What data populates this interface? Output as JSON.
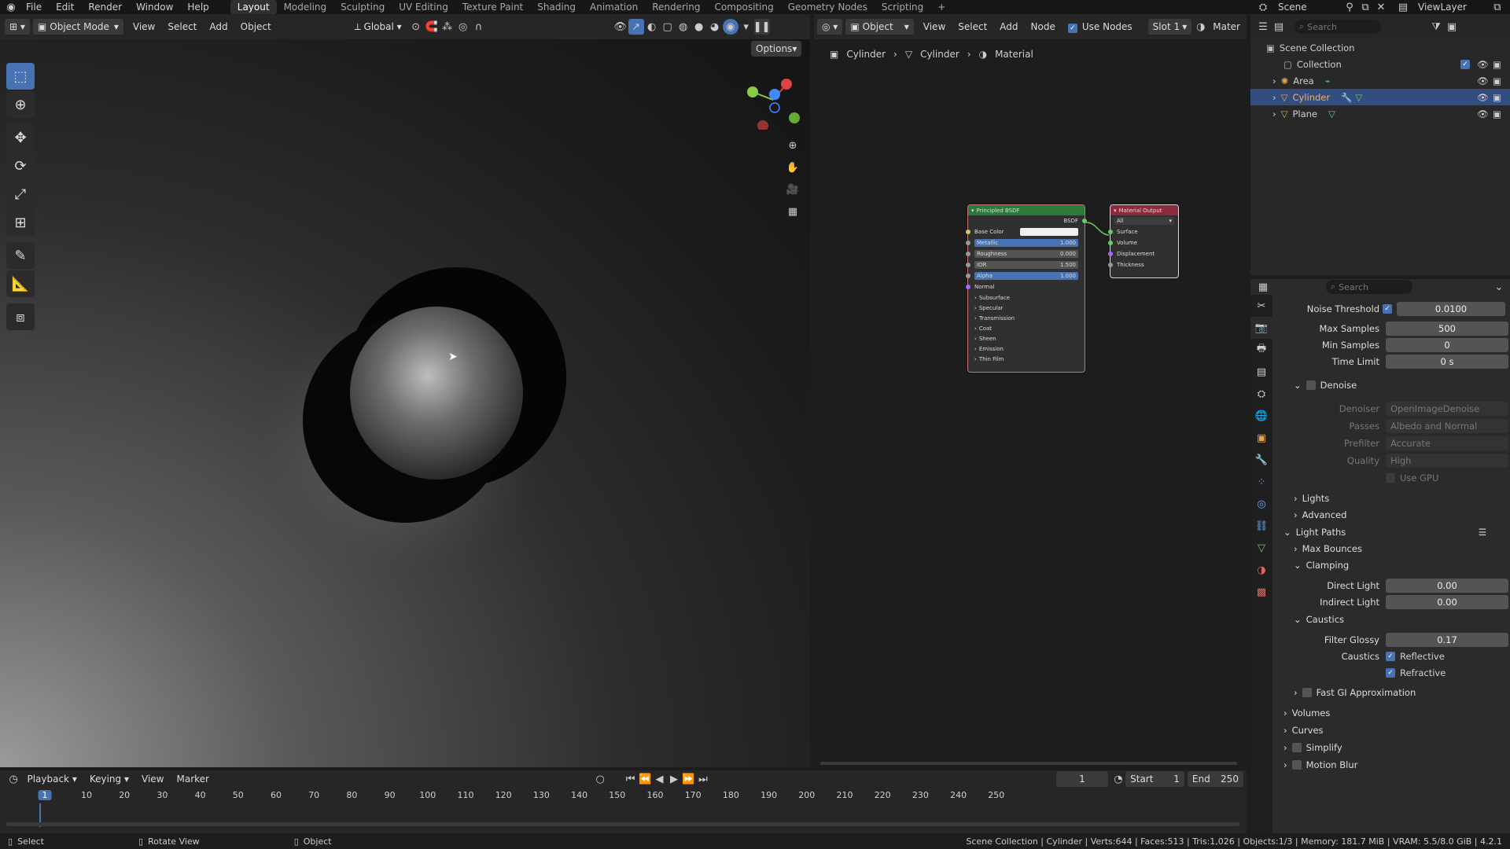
{
  "menu": [
    "File",
    "Edit",
    "Render",
    "Window",
    "Help"
  ],
  "workspaces": [
    "Layout",
    "Modeling",
    "Sculpting",
    "UV Editing",
    "Texture Paint",
    "Shading",
    "Animation",
    "Rendering",
    "Compositing",
    "Geometry Nodes",
    "Scripting"
  ],
  "scene": {
    "label": "Scene",
    "view_layer": "ViewLayer"
  },
  "viewport_header": {
    "mode": "Object Mode",
    "menus": [
      "View",
      "Select",
      "Add",
      "Object"
    ],
    "orientation": "Global",
    "options": "Options"
  },
  "node_header": {
    "type": "Object",
    "menus": [
      "View",
      "Select",
      "Add",
      "Node"
    ],
    "use_nodes": "Use Nodes",
    "slot": "Slot 1",
    "material": "Mater"
  },
  "breadcrumb": [
    "Cylinder",
    "Cylinder",
    "Material"
  ],
  "bsdf_node": {
    "title": "Principled BSDF",
    "output": "BSDF",
    "base_color": "Base Color",
    "fields": [
      {
        "label": "Metallic",
        "value": "1.000",
        "blue": true
      },
      {
        "label": "Roughness",
        "value": "0.000",
        "blue": false
      },
      {
        "label": "IOR",
        "value": "1.500",
        "blue": false
      },
      {
        "label": "Alpha",
        "value": "1.000",
        "blue": true
      }
    ],
    "normal": "Normal",
    "panels": [
      "Subsurface",
      "Specular",
      "Transmission",
      "Coat",
      "Sheen",
      "Emission",
      "Thin Film"
    ]
  },
  "output_node": {
    "title": "Material Output",
    "target": "All",
    "inputs": [
      "Surface",
      "Volume",
      "Displacement",
      "Thickness"
    ]
  },
  "outliner": {
    "search_placeholder": "Search",
    "items": [
      {
        "name": "Scene Collection",
        "indent": 0,
        "selected": false
      },
      {
        "name": "Collection",
        "indent": 1,
        "selected": false
      },
      {
        "name": "Area",
        "indent": 2,
        "selected": false
      },
      {
        "name": "Cylinder",
        "indent": 2,
        "selected": true
      },
      {
        "name": "Plane",
        "indent": 2,
        "selected": false
      }
    ]
  },
  "properties": {
    "search_placeholder": "Search",
    "noise_threshold": {
      "label": "Noise Threshold",
      "value": "0.0100"
    },
    "max_samples": {
      "label": "Max Samples",
      "value": "500"
    },
    "min_samples": {
      "label": "Min Samples",
      "value": "0"
    },
    "time_limit": {
      "label": "Time Limit",
      "value": "0 s"
    },
    "denoise": "Denoise",
    "denoiser": {
      "label": "Denoiser",
      "value": "OpenImageDenoise"
    },
    "passes": {
      "label": "Passes",
      "value": "Albedo and Normal"
    },
    "prefilter": {
      "label": "Prefilter",
      "value": "Accurate"
    },
    "quality": {
      "label": "Quality",
      "value": "High"
    },
    "use_gpu": "Use GPU",
    "lights": "Lights",
    "advanced": "Advanced",
    "light_paths": "Light Paths",
    "max_bounces": "Max Bounces",
    "clamping": "Clamping",
    "direct_light": {
      "label": "Direct Light",
      "value": "0.00"
    },
    "indirect_light": {
      "label": "Indirect Light",
      "value": "0.00"
    },
    "caustics_section": "Caustics",
    "filter_glossy": {
      "label": "Filter Glossy",
      "value": "0.17"
    },
    "caustics_label": "Caustics",
    "reflective": "Reflective",
    "refractive": "Refractive",
    "fast_gi": "Fast GI Approximation",
    "volumes": "Volumes",
    "curves": "Curves",
    "simplify": "Simplify",
    "motion_blur": "Motion Blur"
  },
  "timeline": {
    "menus": [
      "Playback",
      "Keying",
      "View",
      "Marker"
    ],
    "current_frame": "1",
    "start_label": "Start",
    "start": "1",
    "end_label": "End",
    "end": "250",
    "ticks": [
      "1",
      "10",
      "20",
      "30",
      "40",
      "50",
      "60",
      "70",
      "80",
      "90",
      "100",
      "110",
      "120",
      "130",
      "140",
      "150",
      "160",
      "170",
      "180",
      "190",
      "200",
      "210",
      "220",
      "230",
      "240",
      "250"
    ]
  },
  "status": {
    "select": "Select",
    "rotate": "Rotate View",
    "object": "Object",
    "stats": "Scene Collection | Cylinder | Verts:644 | Faces:513 | Tris:1,026 | Objects:1/3 | Memory: 181.7 MiB | VRAM: 5.5/8.0 GiB | 4.2.1"
  },
  "colors": {
    "accent": "#4772b3",
    "bsdf_header": "#2c7a3a",
    "output_header": "#8a2a3a",
    "selected_row": "#334d80"
  }
}
